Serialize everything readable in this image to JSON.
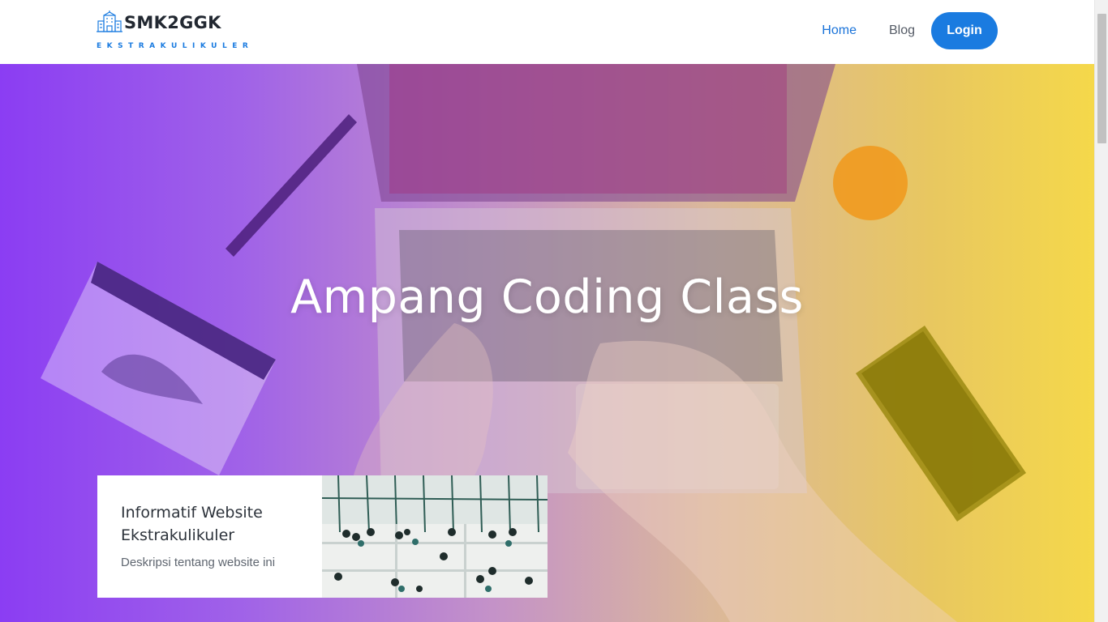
{
  "brand": {
    "name": "SMK2GGK",
    "tagline": "EKSTRAKULIKULER",
    "logo_icon": "school-building-icon"
  },
  "nav": {
    "home": "Home",
    "blog": "Blog",
    "login": "Login"
  },
  "hero": {
    "title": "Ampang Coding Class"
  },
  "card": {
    "title": "Informatif Website Ekstrakulikuler",
    "description": "Deskripsi tentang website ini",
    "image": "people-in-office-hall-photo"
  },
  "colors": {
    "accent": "#1a7be0",
    "gradient_start": "#8b3df3",
    "gradient_end": "#f5d84a"
  }
}
